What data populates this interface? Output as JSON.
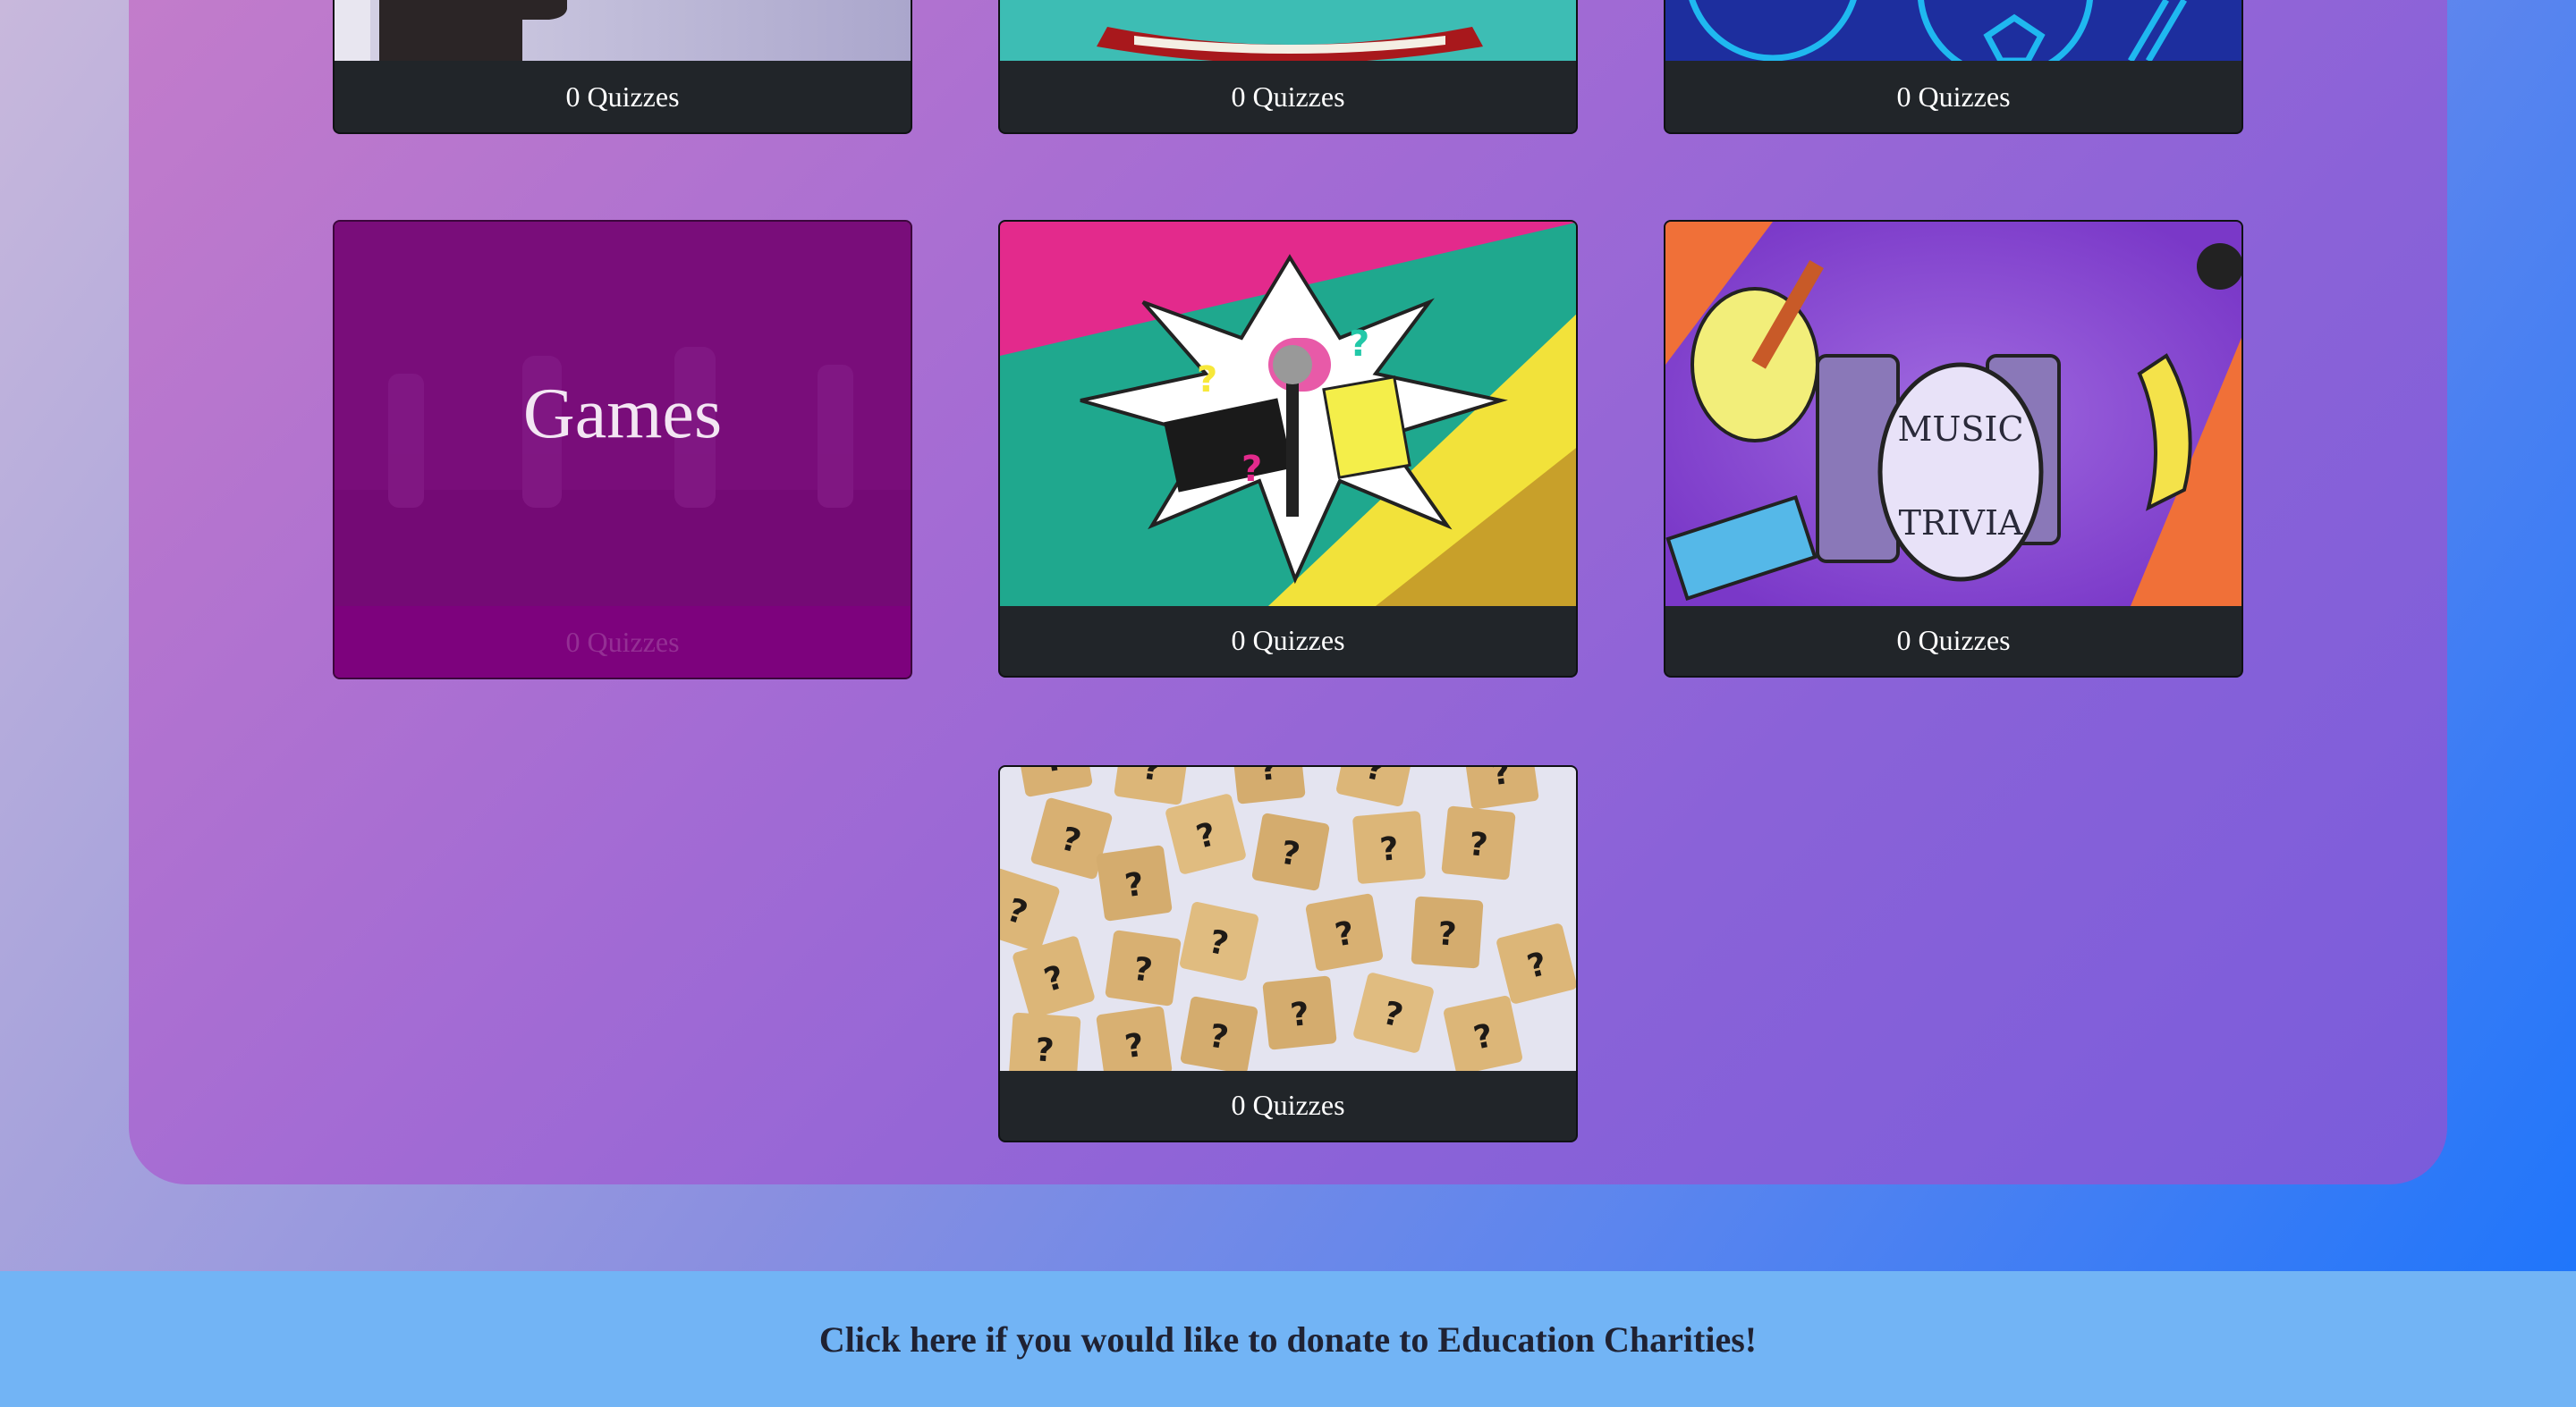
{
  "categories": [
    {
      "count_label": "0 Quizzes",
      "icon": "portrait-silhouette-image"
    },
    {
      "count_label": "0 Quizzes",
      "icon": "open-book-image"
    },
    {
      "count_label": "0 Quizzes",
      "icon": "globe-pattern-image"
    },
    {
      "title": "Games",
      "count_label": "0 Quizzes",
      "icon": "chess-pieces-image"
    },
    {
      "count_label": "0 Quizzes",
      "icon": "pop-culture-collage-image"
    },
    {
      "count_label": "0 Quizzes",
      "icon": "music-trivia-image"
    },
    {
      "count_label": "0 Quizzes",
      "icon": "question-mark-tiles-image"
    }
  ],
  "music_badge": {
    "line1": "MUSIC",
    "line2": "TRIVIA"
  },
  "footer": {
    "donate_link": "Click here if you would like to donate to Education Charities!"
  }
}
